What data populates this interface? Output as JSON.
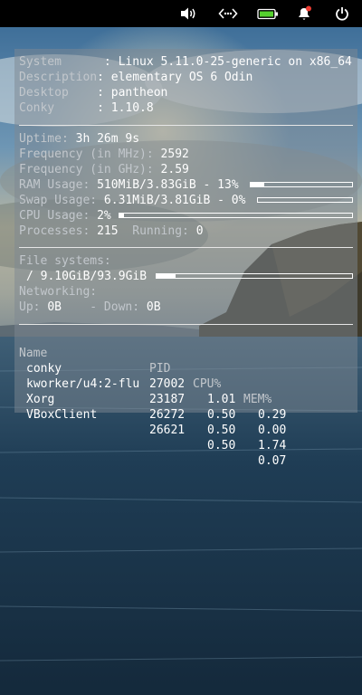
{
  "panel": {
    "icons": [
      "volume-icon",
      "network-wired-icon",
      "battery-icon",
      "notification-bell-icon",
      "power-icon"
    ],
    "colors": {
      "battery": "#55d12e",
      "notification_badge": "#ed3c32"
    }
  },
  "conky": {
    "system": {
      "system_label": "System      ",
      "system_value": ": Linux 5.11.0-25-generic on x86_64",
      "description_label": "Description",
      "description_value": ": elementary OS 6 Odin",
      "desktop_label": "Desktop    ",
      "desktop_value": ": pantheon",
      "conky_label": "Conky      ",
      "conky_value": ": 1.10.8"
    },
    "stats": {
      "uptime_label": "Uptime:",
      "uptime_value": "3h 26m 9s",
      "freq_mhz_label": "Frequency (in MHz):",
      "freq_mhz_value": "2592",
      "freq_ghz_label": "Frequency (in GHz):",
      "freq_ghz_value": "2.59",
      "ram_label": "RAM Usage:",
      "ram_value": "510MiB/3.83GiB - 13%",
      "ram_fraction": 0.13,
      "swap_label": "Swap Usage:",
      "swap_value": "6.31MiB/3.81GiB - 0%",
      "swap_fraction": 0.0,
      "cpu_label": "CPU Usage:",
      "cpu_value": "2%",
      "cpu_fraction": 0.02,
      "processes_label": "Processes:",
      "processes_value": "215",
      "running_label": "Running:",
      "running_value": "0"
    },
    "fs": {
      "title": "File systems:",
      "root_value": "/ 9.10GiB/93.9GiB",
      "root_fraction": 0.097,
      "networking_label": "Networking:",
      "up_label": "Up:",
      "up_value": "0B",
      "down_label": "- Down:",
      "down_value": "0B"
    },
    "procs": {
      "headers": [
        "Name",
        "PID",
        "CPU%",
        "MEM%"
      ],
      "rows": [
        {
          "name": "conky",
          "pid": "27002",
          "cpu": "1.01",
          "mem": "0.29"
        },
        {
          "name": "kworker/u4:2-flu",
          "pid": "23187",
          "cpu": "0.50",
          "mem": "0.00"
        },
        {
          "name": "Xorg",
          "pid": "26272",
          "cpu": "0.50",
          "mem": "1.74"
        },
        {
          "name": "VBoxClient",
          "pid": "26621",
          "cpu": "0.50",
          "mem": "0.07"
        }
      ]
    }
  }
}
